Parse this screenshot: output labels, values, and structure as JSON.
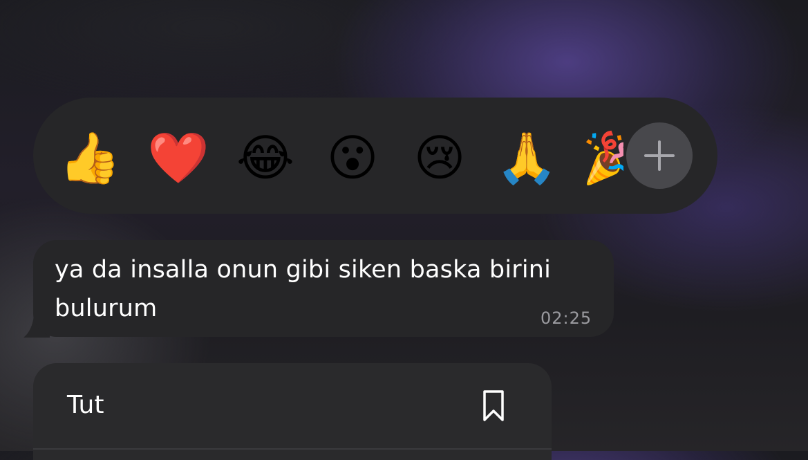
{
  "reactions": {
    "emojis": [
      {
        "name": "thumbs-up",
        "glyph": "👍"
      },
      {
        "name": "red-heart",
        "glyph": "❤️"
      },
      {
        "name": "tears-of-joy",
        "glyph": "😂"
      },
      {
        "name": "surprised-face",
        "glyph": "😮"
      },
      {
        "name": "crying-face",
        "glyph": "😢"
      },
      {
        "name": "folded-hands",
        "glyph": "🙏"
      },
      {
        "name": "party-popper",
        "glyph": "🎉"
      }
    ],
    "more_icon": "plus-icon"
  },
  "message": {
    "text": "ya da insalla onun gibi siken baska birini bulurum",
    "time": "02:25"
  },
  "context_menu": {
    "items": [
      {
        "label": "Tut",
        "icon": "bookmark-icon"
      }
    ]
  },
  "colors": {
    "bubble": "#262628",
    "menu": "#2a2a2c",
    "plus_button": "#48484c",
    "timestamp": "#9a9a9f"
  }
}
